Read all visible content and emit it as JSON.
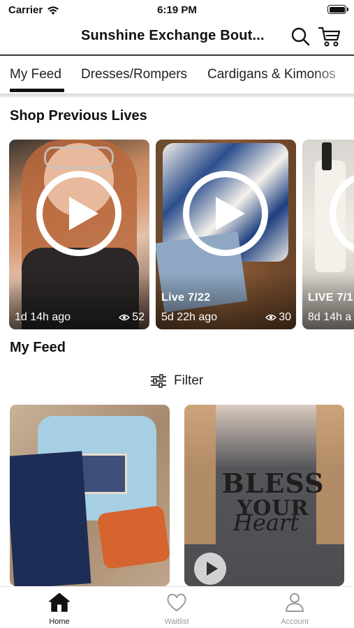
{
  "status_bar": {
    "carrier": "Carrier",
    "time": "6:19 PM"
  },
  "header": {
    "title": "Sunshine Exchange Bout..."
  },
  "tabs": [
    {
      "label": "My Feed"
    },
    {
      "label": "Dresses/Rompers"
    },
    {
      "label": "Cardigans & Kimonos"
    }
  ],
  "previous_lives": {
    "title": "Shop Previous Lives",
    "cards": [
      {
        "label": "",
        "ago": "1d 14h ago",
        "views": "52"
      },
      {
        "label": "Live 7/22",
        "ago": "5d 22h ago",
        "views": "30"
      },
      {
        "label": "LIVE 7/1",
        "ago": "8d 14h a",
        "views": ""
      }
    ]
  },
  "feed": {
    "title": "My Feed",
    "filter_label": "Filter"
  },
  "tile_print": {
    "line1": "BLESS",
    "line2": "YOUR",
    "script": "Heart"
  },
  "tabbar": {
    "home": "Home",
    "waitlist": "Waitlist",
    "account": "Account"
  },
  "colors": {
    "text": "#111111",
    "muted": "#9a9a9a",
    "active_underline": "#111111"
  }
}
